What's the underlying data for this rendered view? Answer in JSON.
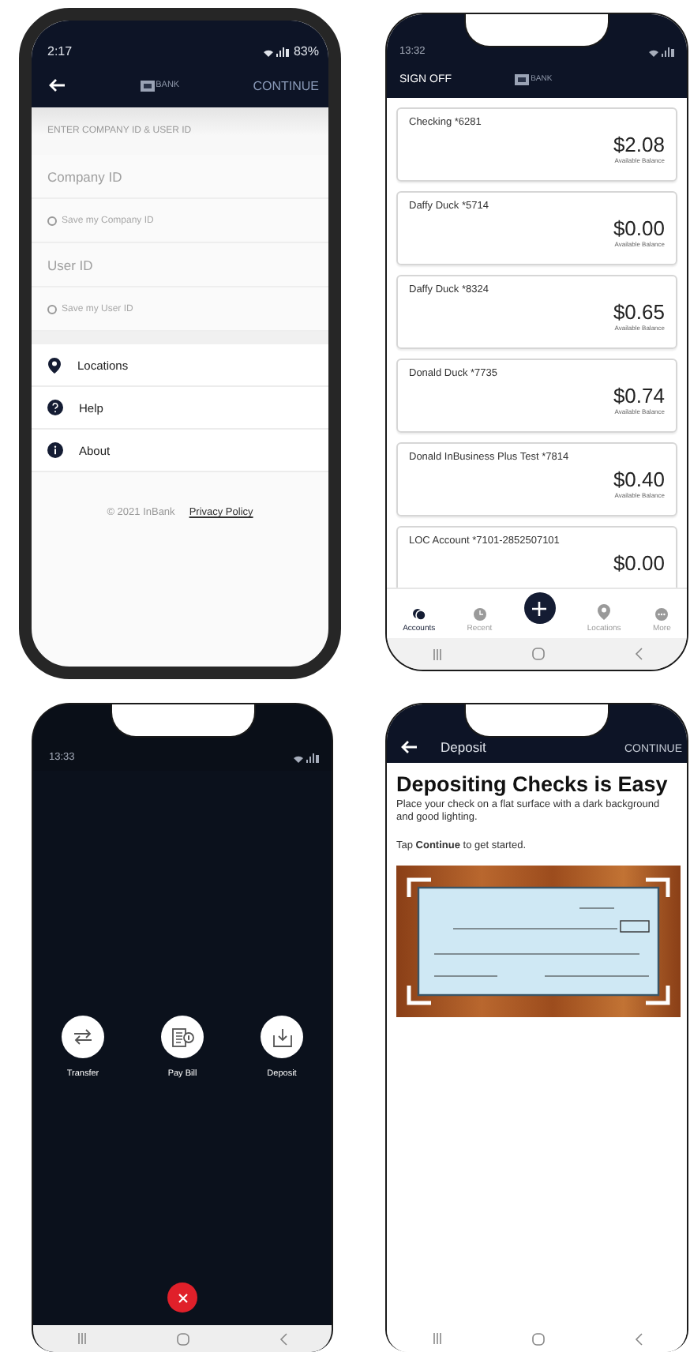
{
  "login_screen": {
    "status_bar": {
      "time": "2:17",
      "battery": "83%"
    },
    "header": {
      "logo": "BANK",
      "action": "CONTINUE"
    },
    "section_label": "ENTER COMPANY ID & USER ID",
    "fields": [
      {
        "placeholder": "Company ID",
        "save_label": "Save my Company ID",
        "save_checked": false
      },
      {
        "placeholder": "User ID",
        "save_label": "Save my User ID",
        "save_checked": false
      }
    ],
    "menu": [
      {
        "label": "Locations",
        "kind": "location"
      },
      {
        "label": "Help",
        "kind": "help"
      },
      {
        "label": "About",
        "kind": "info"
      }
    ],
    "footer": {
      "copyright": "© 2021 InBank",
      "link": "Privacy Policy"
    }
  },
  "accounts_screen": {
    "status_time": "13:32",
    "header": {
      "action": "SIGN OFF",
      "logo": "BANK"
    },
    "accounts": [
      {
        "name": "Checking *6281",
        "balance": "$2.08",
        "caption": "Available Balance"
      },
      {
        "name": "Daffy Duck *5714",
        "balance": "$0.00",
        "caption": "Available Balance"
      },
      {
        "name": "Daffy Duck *8324",
        "balance": "$0.65",
        "caption": "Available Balance"
      },
      {
        "name": "Donald Duck *7735",
        "balance": "$0.74",
        "caption": "Available Balance"
      },
      {
        "name": "Donald InBusiness Plus Test *7814",
        "balance": "$0.40",
        "caption": "Available Balance"
      },
      {
        "name": "LOC Account *7101-2852507101",
        "balance": "$0.00"
      }
    ],
    "nav": [
      {
        "kind": "accounts",
        "label": "Accounts",
        "selected": true
      },
      {
        "kind": "recent",
        "label": "Recent",
        "selected": false
      },
      {
        "kind": "add",
        "selected": false
      },
      {
        "kind": "location",
        "label": "Locations",
        "selected": false
      },
      {
        "kind": "more",
        "label": "More",
        "selected": false
      }
    ]
  },
  "actions_screen": {
    "status_time": "13:33",
    "actions": [
      {
        "kind": "transfer",
        "label": "Transfer"
      },
      {
        "kind": "bill",
        "label": "Pay Bill"
      },
      {
        "kind": "deposit",
        "label": "Deposit"
      }
    ]
  },
  "deposit_screen": {
    "title": "Deposit",
    "action": "CONTINUE",
    "heading": "Depositing Checks is Easy",
    "instructions": "Place your check on a flat surface with a dark background and good lighting.",
    "prompt": "Tap **Continue** to get started."
  }
}
